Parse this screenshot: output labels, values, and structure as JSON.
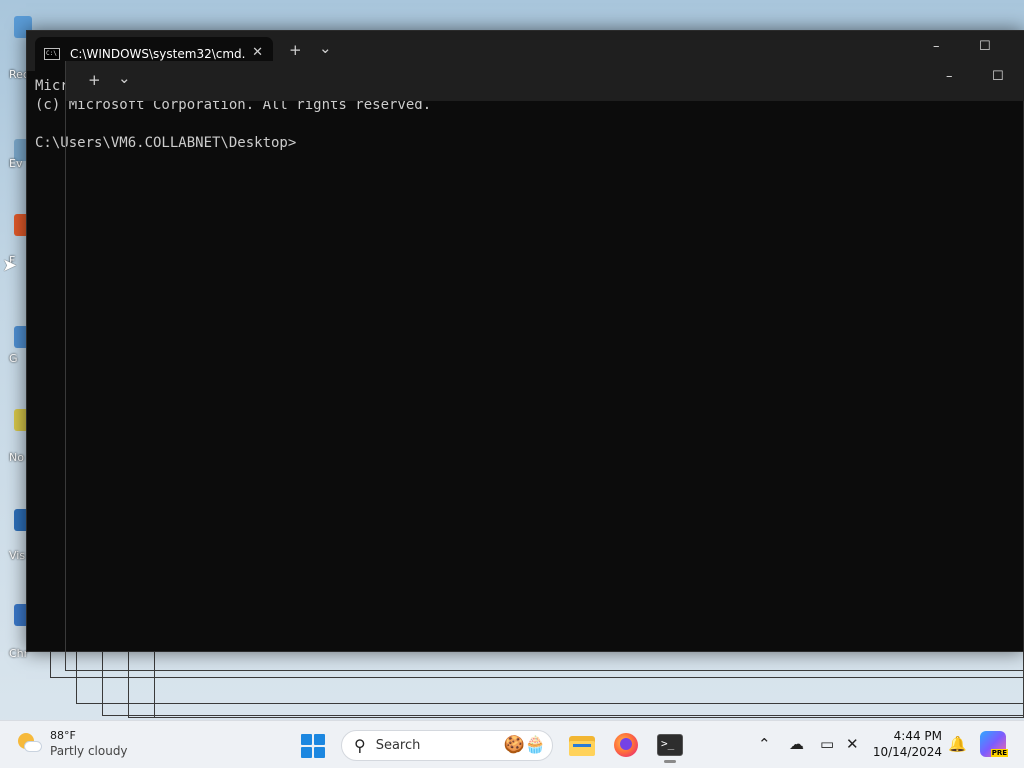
{
  "desktop": {
    "icons": [
      {
        "label": "Rec",
        "color": "#5a9bd6"
      },
      {
        "label": "Ev",
        "color": "#7aa7c9"
      },
      {
        "label": "F",
        "color": "#e0592a"
      },
      {
        "label": "G",
        "color": "#4f8fd1"
      },
      {
        "label": "No",
        "color": "#d6c64a"
      },
      {
        "label": "Vis",
        "color": "#2d6fb9"
      },
      {
        "label": "Chr",
        "color": "#3b78c9"
      }
    ]
  },
  "terminal": {
    "tab_title": "C:\\WINDOWS\\system32\\cmd.",
    "tab_icon_text": "C:\\",
    "new_tab": "+",
    "dropdown": "⌄",
    "minimize": "–",
    "maximize": "☐",
    "inner_new_tab": "+",
    "inner_dropdown": "⌄",
    "lines": [
      "Micr",
      "(c) Microsoft Corporation. All rights reserved.",
      "C:\\Users\\VM6.COLLABNET\\Desktop>"
    ]
  },
  "taskbar": {
    "weather": {
      "temp": "88°F",
      "condition": "Partly cloudy"
    },
    "search_label": "Search",
    "clock": {
      "time": "4:44 PM",
      "date": "10/14/2024"
    },
    "copilot_badge": "PRE"
  }
}
